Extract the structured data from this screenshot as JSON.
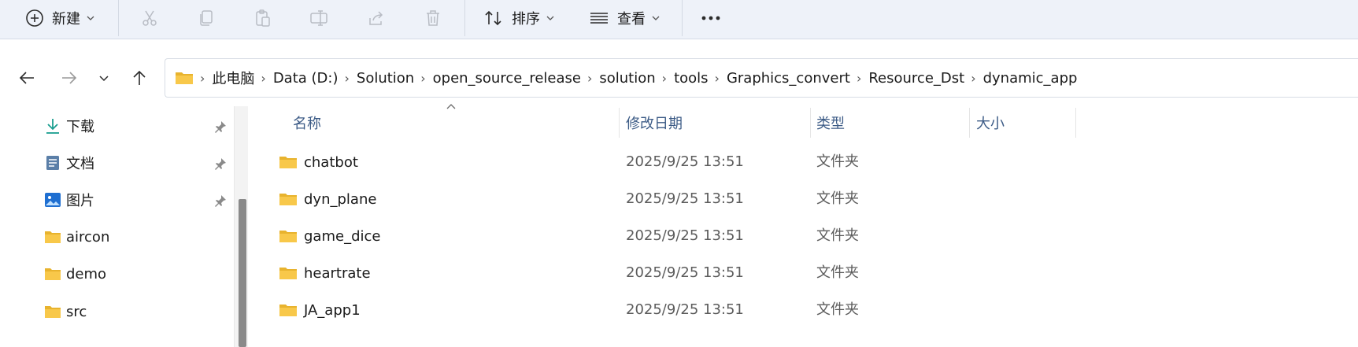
{
  "toolbar": {
    "new_label": "新建",
    "sort_label": "排序",
    "view_label": "查看",
    "icons": [
      "plus-circle-icon",
      "cut-icon",
      "copy-icon",
      "paste-icon",
      "rename-icon",
      "share-icon",
      "delete-icon",
      "sort-icon",
      "view-icon",
      "more-icon"
    ]
  },
  "breadcrumb": [
    "此电脑",
    "Data (D:)",
    "Solution",
    "open_source_release",
    "solution",
    "tools",
    "Graphics_convert",
    "Resource_Dst",
    "dynamic_app"
  ],
  "sidebar": {
    "items": [
      {
        "label": "下载",
        "icon": "download-icon",
        "pinned": true
      },
      {
        "label": "文档",
        "icon": "document-icon",
        "pinned": true
      },
      {
        "label": "图片",
        "icon": "pictures-icon",
        "pinned": true
      },
      {
        "label": "aircon",
        "icon": "folder-icon",
        "pinned": false
      },
      {
        "label": "demo",
        "icon": "folder-icon",
        "pinned": false
      },
      {
        "label": "src",
        "icon": "folder-icon",
        "pinned": false
      }
    ]
  },
  "columns": {
    "name": "名称",
    "date": "修改日期",
    "type": "类型",
    "size": "大小"
  },
  "files": [
    {
      "name": "chatbot",
      "date": "2025/9/25 13:51",
      "type": "文件夹"
    },
    {
      "name": "dyn_plane",
      "date": "2025/9/25 13:51",
      "type": "文件夹"
    },
    {
      "name": "game_dice",
      "date": "2025/9/25 13:51",
      "type": "文件夹"
    },
    {
      "name": "heartrate",
      "date": "2025/9/25 13:51",
      "type": "文件夹"
    },
    {
      "name": "JA_app1",
      "date": "2025/9/25 13:51",
      "type": "文件夹"
    }
  ],
  "colors": {
    "folder": "#f8c84a",
    "header_text": "#3c5b86",
    "toolbar_bg": "#eef2f9",
    "accent_blue": "#1f6fd1"
  }
}
